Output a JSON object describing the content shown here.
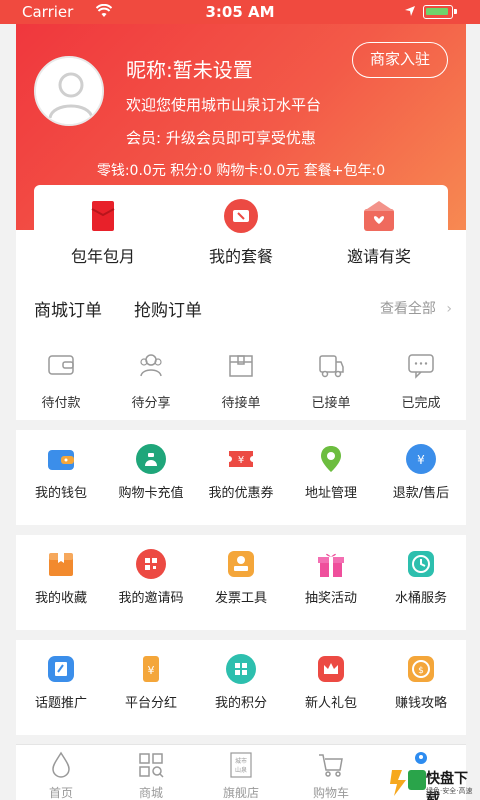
{
  "status": {
    "carrier": "Carrier",
    "time": "3:05 AM"
  },
  "profile": {
    "nickname": "昵称:暂未设置",
    "merchant_button": "商家入驻",
    "welcome": "欢迎您使用城市山泉订水平台",
    "member": "会员: 升级会员即可享受优惠",
    "stats": "零钱:0.0元  积分:0  购物卡:0.0元  套餐+包年:0"
  },
  "quick": [
    {
      "label": "包年包月",
      "icon": "red-envelope-icon"
    },
    {
      "label": "我的套餐",
      "icon": "ticket-icon"
    },
    {
      "label": "邀请有奖",
      "icon": "gift-mail-icon"
    }
  ],
  "orders": {
    "tabs": [
      "商城订单",
      "抢购订单"
    ],
    "view_all": "查看全部",
    "items": [
      {
        "label": "待付款",
        "icon": "wallet-outline-icon"
      },
      {
        "label": "待分享",
        "icon": "users-outline-icon"
      },
      {
        "label": "待接单",
        "icon": "box-outline-icon"
      },
      {
        "label": "已接单",
        "icon": "truck-outline-icon"
      },
      {
        "label": "已完成",
        "icon": "chat-outline-icon"
      }
    ]
  },
  "services": {
    "row1": [
      "我的钱包",
      "购物卡充值",
      "我的优惠券",
      "地址管理",
      "退款/售后"
    ],
    "row2": [
      "我的收藏",
      "我的邀请码",
      "发票工具",
      "抽奖活动",
      "水桶服务"
    ],
    "row3": [
      "话题推广",
      "平台分红",
      "我的积分",
      "新人礼包",
      "赚钱攻略"
    ]
  },
  "tabbar": [
    {
      "label": "首页",
      "icon": "water-drop-icon"
    },
    {
      "label": "商城",
      "icon": "grid-search-icon"
    },
    {
      "label": "旗舰店",
      "icon": "store-seal-icon"
    },
    {
      "label": "购物车",
      "icon": "cart-icon"
    },
    {
      "label": "",
      "icon": "profile-icon"
    }
  ],
  "watermark": {
    "text": "快盘下载",
    "sub": "绿色·安全·高速"
  },
  "colors": {
    "header": "#f0373d",
    "accent": "#2d8cf0"
  }
}
